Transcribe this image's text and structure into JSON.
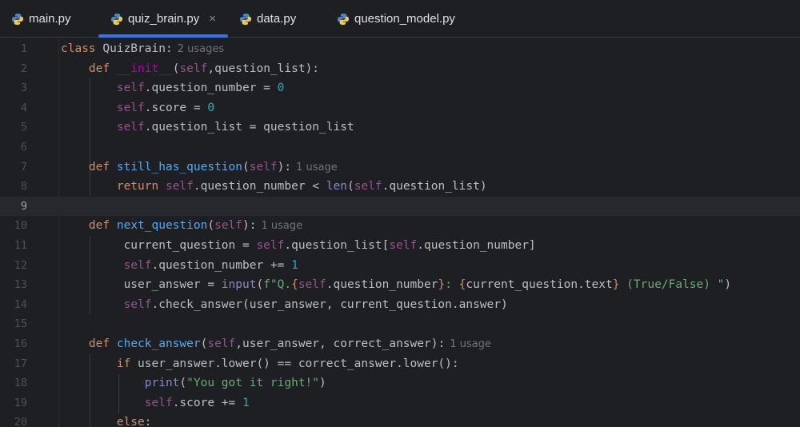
{
  "tabs": [
    {
      "label": "main.py",
      "active": false
    },
    {
      "label": "quiz_brain.py",
      "active": true,
      "close": "×"
    },
    {
      "label": "data.py",
      "active": false
    },
    {
      "label": "question_model.py",
      "active": false
    }
  ],
  "accent_color": "#3574f0",
  "current_line": 9,
  "lines": [
    {
      "n": "1",
      "class_kw": "class",
      "class_name": "QuizBrain",
      "colon": ":",
      "hint": "2 usages"
    },
    {
      "n": "2",
      "def": "def",
      "name": "__init__",
      "p1": "(",
      "self": "self",
      "rest": ",question_list):"
    },
    {
      "n": "3",
      "self": "self",
      "a": ".question_number = ",
      "num": "0"
    },
    {
      "n": "4",
      "self": "self",
      "a": ".score = ",
      "num": "0"
    },
    {
      "n": "5",
      "self": "self",
      "a": ".question_list = question_list"
    },
    {
      "n": "6"
    },
    {
      "n": "7",
      "def": "def",
      "name": "still_has_question",
      "p1": "(",
      "self": "self",
      "rest": "):",
      "hint": "1 usage"
    },
    {
      "n": "8",
      "kw": "return",
      "self": "self",
      "a": ".question_number < ",
      "builtin": "len",
      "b": "(",
      "self2": "self",
      "c": ".question_list)"
    },
    {
      "n": "9"
    },
    {
      "n": "10",
      "def": "def",
      "name": "next_question",
      "p1": "(",
      "self": "self",
      "rest": "):",
      "hint": "1 usage"
    },
    {
      "n": "11",
      "a": "current_question = ",
      "self": "self",
      "b": ".question_list[",
      "self2": "self",
      "c": ".question_number]"
    },
    {
      "n": "12",
      "self": "self",
      "a": ".question_number += ",
      "num": "1"
    },
    {
      "n": "13",
      "a": "user_answer = ",
      "builtin": "input",
      "b": "(",
      "s1": "f\"Q.",
      "br1": "{",
      "self": "self",
      "c": ".question_number",
      "br2": "}",
      "s2": ": ",
      "br3": "{",
      "d": "current_question.text",
      "br4": "}",
      "s3": " (True/False) \"",
      "e": ")"
    },
    {
      "n": "14",
      "self": "self",
      "a": ".check_answer(user_answer, current_question.answer)"
    },
    {
      "n": "15"
    },
    {
      "n": "16",
      "def": "def",
      "name": "check_answer",
      "p1": "(",
      "self": "self",
      "rest": ",user_answer, correct_answer):",
      "hint": "1 usage"
    },
    {
      "n": "17",
      "kw": "if",
      "a": " user_answer.lower() == correct_answer.lower():"
    },
    {
      "n": "18",
      "builtin": "print",
      "b": "(",
      "s1": "\"You got it right!\"",
      "c": ")"
    },
    {
      "n": "19",
      "self": "self",
      "a": ".score += ",
      "num": "1"
    },
    {
      "n": "20",
      "kw": "else",
      "a": ":"
    }
  ]
}
